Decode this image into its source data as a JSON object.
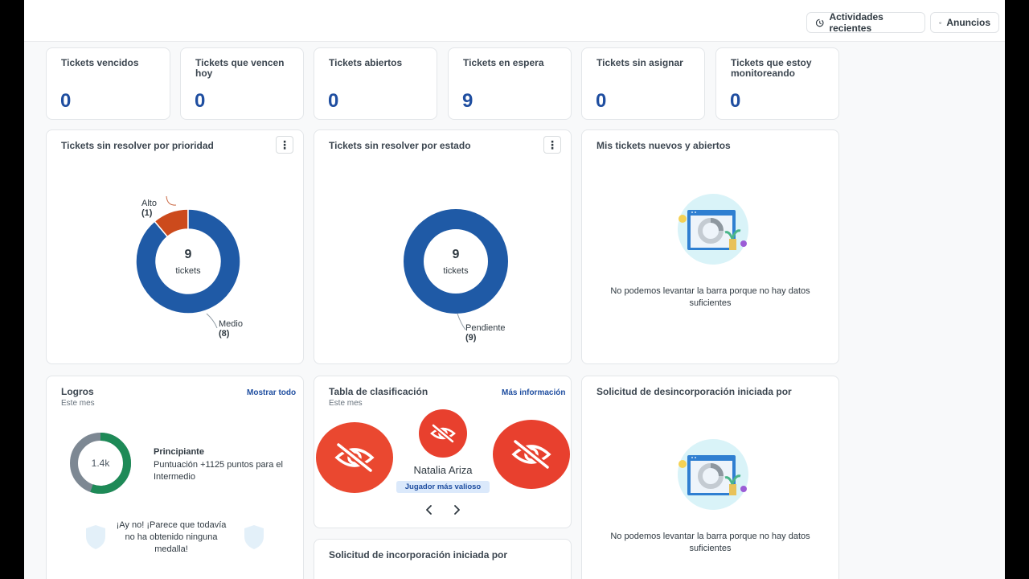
{
  "topbar": {
    "recent_label": "Actividades recientes",
    "announce_label": "Anuncios"
  },
  "kpis": [
    {
      "label": "Tickets vencidos",
      "value": "0"
    },
    {
      "label": "Tickets que vencen hoy",
      "value": "0"
    },
    {
      "label": "Tickets abiertos",
      "value": "0"
    },
    {
      "label": "Tickets en espera",
      "value": "9"
    },
    {
      "label": "Tickets sin asignar",
      "value": "0"
    },
    {
      "label": "Tickets que estoy monitoreando",
      "value": "0"
    }
  ],
  "priority_chart": {
    "title": "Tickets sin resolver por prioridad",
    "center_value": "9",
    "center_unit": "tickets",
    "high_label": "Alto",
    "high_count": "(1)",
    "mid_label": "Medio",
    "mid_count": "(8)"
  },
  "status_chart": {
    "title": "Tickets sin resolver por estado",
    "center_value": "9",
    "center_unit": "tickets",
    "pending_label": "Pendiente",
    "pending_count": "(9)"
  },
  "my_tickets": {
    "title": "Mis tickets nuevos y abiertos",
    "empty_line1": "No podemos levantar la barra porque no hay datos",
    "empty_line2": "suficientes"
  },
  "achievements": {
    "title": "Logros",
    "subtitle": "Este mes",
    "show_all": "Mostrar todo",
    "ring_value": "1.4k",
    "level": "Principiante",
    "points_line1": "Puntuación +1125 puntos para el",
    "points_line2": "Intermedio",
    "medal_line1": "¡Ay no! ¡Parece que todavía",
    "medal_line2": "no ha obtenido ninguna",
    "medal_line3": "medalla!"
  },
  "leaderboard": {
    "title": "Tabla de clasificación",
    "subtitle": "Este mes",
    "more_info": "Más información",
    "player_name": "Natalia Ariza",
    "badge": "Jugador más valioso"
  },
  "onboarding": {
    "title": "Solicitud de incorporación iniciada por"
  },
  "offboarding": {
    "title": "Solicitud de desincorporación iniciada por",
    "empty_line1": "No podemos levantar la barra porque no hay datos",
    "empty_line2": "suficientes"
  },
  "chart_data": [
    {
      "type": "pie",
      "title": "Tickets sin resolver por prioridad",
      "categories": [
        "Alto",
        "Medio"
      ],
      "values": [
        1,
        8
      ],
      "colors": [
        "#cc4a1c",
        "#1f5aa6"
      ]
    },
    {
      "type": "pie",
      "title": "Tickets sin resolver por estado",
      "categories": [
        "Pendiente"
      ],
      "values": [
        9
      ],
      "colors": [
        "#1f5aa6"
      ]
    }
  ],
  "colors": {
    "accent": "#1f4ea0",
    "donut_blue": "#1f5aa6",
    "donut_orange": "#cc4a1c",
    "achieve_green": "#1e8a57",
    "achieve_gray": "#7d8893",
    "avatar_red": "#e8402e"
  },
  "icons": [
    "history-icon",
    "megaphone-icon",
    "more-vertical-icon",
    "eye-off-icon",
    "chevron-left-icon",
    "chevron-right-icon",
    "shield-icon",
    "empty-chart-illustration"
  ]
}
